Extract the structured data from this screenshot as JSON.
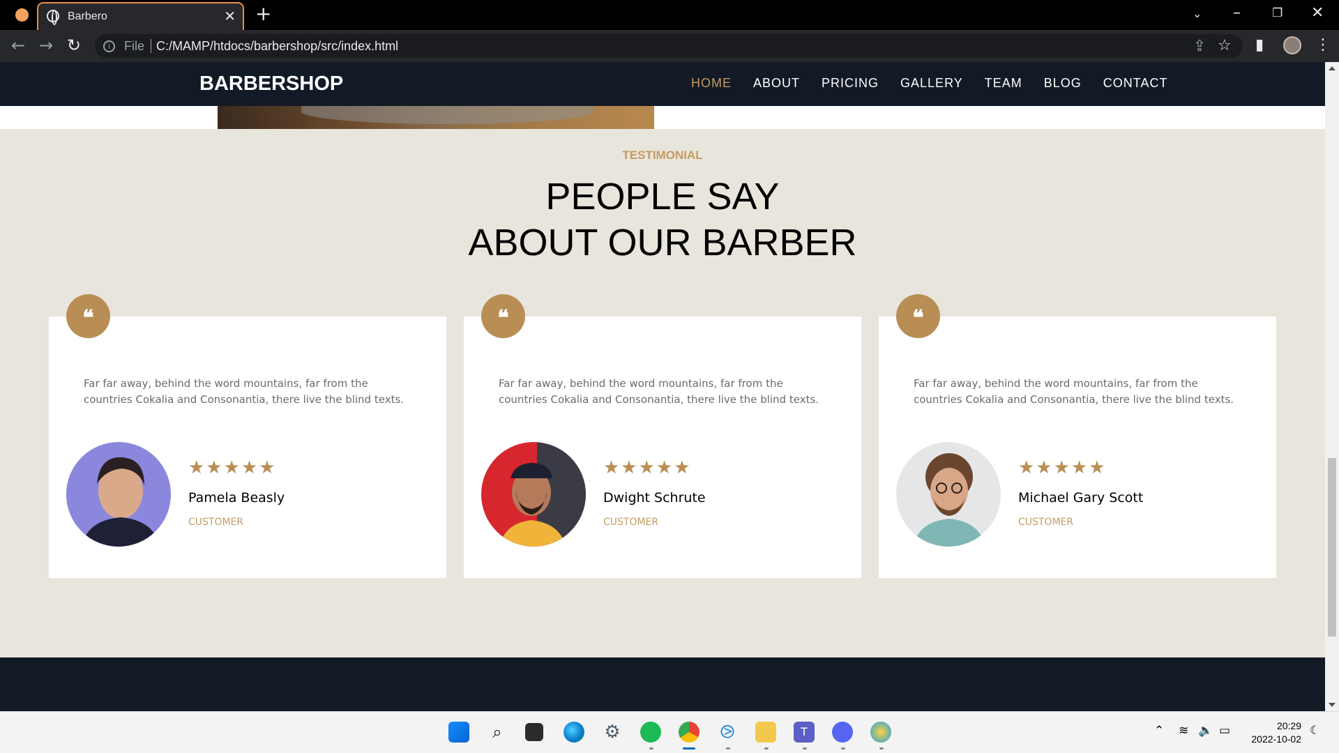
{
  "browser": {
    "tab_title": "Barbero",
    "tab_close": "✕",
    "new_tab": "+",
    "file_label": "File",
    "url": "C:/MAMP/htdocs/barbershop/src/index.html"
  },
  "site": {
    "brand": "BARBERSHOP",
    "menu": [
      "HOME",
      "ABOUT",
      "PRICING",
      "GALLERY",
      "TEAM",
      "BLOG",
      "CONTACT"
    ],
    "active_menu": "HOME"
  },
  "testimonial": {
    "kicker": "TESTIMONIAL",
    "heading_line1": "PEOPLE SAY",
    "heading_line2": "ABOUT OUR BARBER",
    "quote_mark": "❝",
    "cards": [
      {
        "text": "Far far away, behind the word mountains, far from the countries Cokalia and Consonantia, there live the blind texts.",
        "rating": 5,
        "stars": "★★★★★",
        "name": "Pamela Beasly",
        "role": "CUSTOMER"
      },
      {
        "text": "Far far away, behind the word mountains, far from the countries Cokalia and Consonantia, there live the blind texts.",
        "rating": 5,
        "stars": "★★★★★",
        "name": "Dwight Schrute",
        "role": "CUSTOMER"
      },
      {
        "text": "Far far away, behind the word mountains, far from the countries Cokalia and Consonantia, there live the blind texts.",
        "rating": 5,
        "stars": "★★★★★",
        "name": "Michael Gary Scott",
        "role": "CUSTOMER"
      }
    ]
  },
  "taskbar": {
    "time": "20:29",
    "date": "2022-10-02",
    "apps": [
      "start-icon",
      "search-icon",
      "task-view-icon",
      "edge-icon",
      "settings-icon",
      "spotify-icon",
      "chrome-icon",
      "vscode-icon",
      "file-explorer-icon",
      "teams-icon",
      "discord-icon",
      "paint-icon"
    ]
  },
  "colors": {
    "accent": "#c49b63",
    "nav_bg": "#121a26",
    "section_bg": "#e8e5dc",
    "badge": "#b98e55"
  }
}
